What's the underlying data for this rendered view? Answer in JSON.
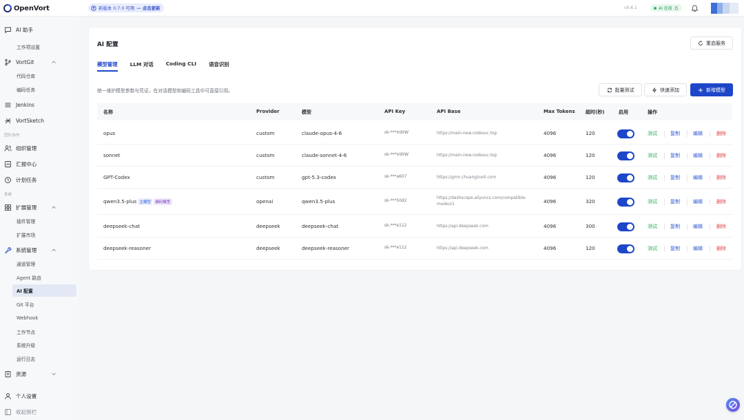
{
  "app": {
    "name": "OpenVort",
    "version": "v0.6.1",
    "status": "AI 在线"
  },
  "update_banner": {
    "text": "新版本 0.7.0 可用",
    "link": "— 点击更新"
  },
  "sidebar": {
    "items": [
      {
        "label": "AI 助手",
        "icon": "chat-icon"
      },
      {
        "label": "工作项设置"
      },
      {
        "label": "VortGit",
        "icon": "git-icon"
      },
      {
        "label": "代码仓库"
      },
      {
        "label": "编码任务"
      },
      {
        "label": "Jenkins",
        "icon": "jenkins-icon"
      },
      {
        "label": "VortSketch",
        "icon": "sketch-icon"
      },
      {
        "label": "团队协作"
      },
      {
        "label": "组织管理",
        "icon": "users-icon"
      },
      {
        "label": "汇报中心",
        "icon": "report-icon"
      },
      {
        "label": "计划任务",
        "icon": "clock-icon"
      },
      {
        "label": "系统"
      },
      {
        "label": "扩展管理",
        "icon": "extension-icon"
      },
      {
        "label": "插件管理"
      },
      {
        "label": "扩展市场"
      },
      {
        "label": "系统管理",
        "icon": "wrench-icon"
      },
      {
        "label": "通道管理"
      },
      {
        "label": "Agent 路由"
      },
      {
        "label": "AI 配置"
      },
      {
        "label": "Git 平台"
      },
      {
        "label": "Webhook"
      },
      {
        "label": "工作节点"
      },
      {
        "label": "系统升级"
      },
      {
        "label": "运行日志"
      },
      {
        "label": "资源",
        "icon": "book-icon"
      },
      {
        "label": "个人设置",
        "icon": "user-icon"
      },
      {
        "label": "收起侧栏",
        "icon": "collapse-icon"
      }
    ]
  },
  "page": {
    "title": "AI 配置",
    "restart_label": "重启服务",
    "tabs": [
      "模型管理",
      "LLM 对话",
      "Coding CLI",
      "语音识别"
    ],
    "description": "统一维护模型参数与凭证，在对话模型和编码工具中可直接引用。",
    "batch_test_label": "批量测试",
    "quick_add_label": "快速添加",
    "add_model_label": "新增模型"
  },
  "table": {
    "headers": [
      "名称",
      "Provider",
      "模型",
      "API Key",
      "API Base",
      "Max Tokens",
      "超时(秒)",
      "启用",
      "操作"
    ],
    "actions": [
      "测试",
      "复制",
      "编辑",
      "删除"
    ],
    "rows": [
      {
        "name": "opus",
        "tags": [],
        "provider": "custom",
        "model": "claude-opus-4-6",
        "api_key": "sk-***VdXW",
        "api_base": "https://main-new.codesuc.top",
        "max_tokens": "4096",
        "timeout": "120",
        "enabled": true
      },
      {
        "name": "sonnet",
        "tags": [],
        "provider": "custom",
        "model": "claude-sonnet-4-6",
        "api_key": "sk-***VdXW",
        "api_base": "https://main-new.codesuc.top",
        "max_tokens": "4096",
        "timeout": "120",
        "enabled": true
      },
      {
        "name": "GPT-Codex",
        "tags": [],
        "provider": "custom",
        "model": "gpt-5.3-codex",
        "api_key": "sk-***a607",
        "api_base": "https://gmn.chuangzuoli.com",
        "max_tokens": "4096",
        "timeout": "120",
        "enabled": true
      },
      {
        "name": "qwen3.5-plus",
        "tags": [
          "主模型",
          "编码模型"
        ],
        "provider": "openai",
        "model": "qwen3.5-plus",
        "api_key": "sk-***50d2",
        "api_base": "https://dashscope.aliyuncs.com/compatible-mode/v1",
        "max_tokens": "4096",
        "timeout": "320",
        "enabled": true
      },
      {
        "name": "deepseek-chat",
        "tags": [],
        "provider": "deepseek",
        "model": "deepseek-chat",
        "api_key": "sk-***e112",
        "api_base": "https://api.deepseek.com",
        "max_tokens": "4096",
        "timeout": "300",
        "enabled": true
      },
      {
        "name": "deepseek-reasoner",
        "tags": [],
        "provider": "deepseek",
        "model": "deepseek-reasoner",
        "api_key": "sk-***e112",
        "api_base": "https://api.deepseek.com",
        "max_tokens": "4096",
        "timeout": "120",
        "enabled": true
      }
    ]
  },
  "colors": {
    "primary": "#1d46c9",
    "success": "#2fa85f",
    "danger": "#e0464a",
    "link": "#2c56d6"
  }
}
